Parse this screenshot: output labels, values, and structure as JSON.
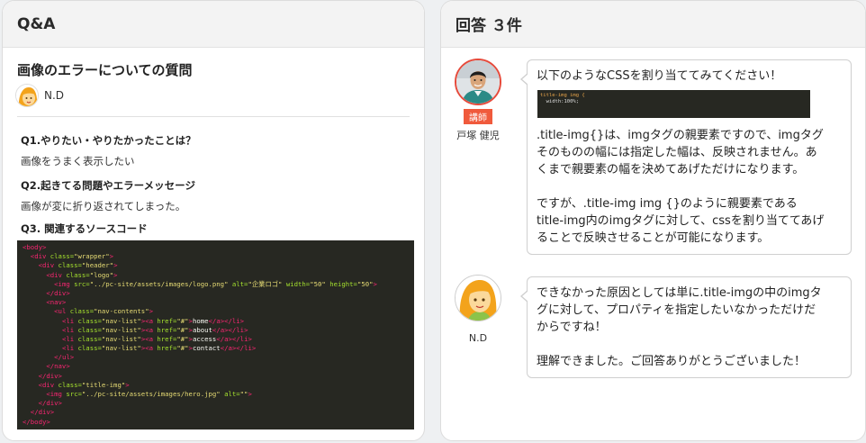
{
  "left_panel": {
    "header": "Q&A",
    "question_title": "画像のエラーについての質問",
    "asker_name": "N.D",
    "q1_heading": "Q1.やりたい・やりたかったことは？",
    "q1_text": "画像をうまく表示したい",
    "q2_heading": "Q2.起きてる問題やエラーメッセージ",
    "q2_text": "画像が変に折り返されてしまった。",
    "q3_heading": "Q3. 関連するソースコード",
    "code_lines": [
      [
        {
          "c": "tg",
          "t": "<body>"
        }
      ],
      [
        {
          "c": "tx",
          "t": "  "
        },
        {
          "c": "tg",
          "t": "<div "
        },
        {
          "c": "at",
          "t": "class="
        },
        {
          "c": "st",
          "t": "\"wrapper\""
        },
        {
          "c": "tg",
          "t": ">"
        }
      ],
      [
        {
          "c": "tx",
          "t": "    "
        },
        {
          "c": "tg",
          "t": "<div "
        },
        {
          "c": "at",
          "t": "class="
        },
        {
          "c": "st",
          "t": "\"header\""
        },
        {
          "c": "tg",
          "t": ">"
        }
      ],
      [
        {
          "c": "tx",
          "t": "      "
        },
        {
          "c": "tg",
          "t": "<div "
        },
        {
          "c": "at",
          "t": "class="
        },
        {
          "c": "st",
          "t": "\"logo\""
        },
        {
          "c": "tg",
          "t": ">"
        }
      ],
      [
        {
          "c": "tx",
          "t": "        "
        },
        {
          "c": "tg",
          "t": "<img "
        },
        {
          "c": "at",
          "t": "src="
        },
        {
          "c": "st",
          "t": "\"../pc-site/assets/images/logo.png\""
        },
        {
          "c": "tx",
          "t": " "
        },
        {
          "c": "at",
          "t": "alt="
        },
        {
          "c": "st",
          "t": "\"企業ロゴ\""
        },
        {
          "c": "tx",
          "t": " "
        },
        {
          "c": "at",
          "t": "width="
        },
        {
          "c": "st",
          "t": "\"50\""
        },
        {
          "c": "tx",
          "t": " "
        },
        {
          "c": "at",
          "t": "height="
        },
        {
          "c": "st",
          "t": "\"50\""
        },
        {
          "c": "tg",
          "t": ">"
        }
      ],
      [
        {
          "c": "tx",
          "t": "      "
        },
        {
          "c": "tg",
          "t": "</div>"
        }
      ],
      [
        {
          "c": "tx",
          "t": "      "
        },
        {
          "c": "tg",
          "t": "<nav>"
        }
      ],
      [
        {
          "c": "tx",
          "t": "        "
        },
        {
          "c": "tg",
          "t": "<ul "
        },
        {
          "c": "at",
          "t": "class="
        },
        {
          "c": "st",
          "t": "\"nav-contents\""
        },
        {
          "c": "tg",
          "t": ">"
        }
      ],
      [
        {
          "c": "tx",
          "t": "          "
        },
        {
          "c": "tg",
          "t": "<li "
        },
        {
          "c": "at",
          "t": "class="
        },
        {
          "c": "st",
          "t": "\"nav-list\""
        },
        {
          "c": "tg",
          "t": "><a "
        },
        {
          "c": "at",
          "t": "href="
        },
        {
          "c": "st",
          "t": "\"#\""
        },
        {
          "c": "tg",
          "t": ">"
        },
        {
          "c": "tx",
          "t": "home"
        },
        {
          "c": "tg",
          "t": "</a></li>"
        }
      ],
      [
        {
          "c": "tx",
          "t": "          "
        },
        {
          "c": "tg",
          "t": "<li "
        },
        {
          "c": "at",
          "t": "class="
        },
        {
          "c": "st",
          "t": "\"nav-list\""
        },
        {
          "c": "tg",
          "t": "><a "
        },
        {
          "c": "at",
          "t": "href="
        },
        {
          "c": "st",
          "t": "\"#\""
        },
        {
          "c": "tg",
          "t": ">"
        },
        {
          "c": "tx",
          "t": "about"
        },
        {
          "c": "tg",
          "t": "</a></li>"
        }
      ],
      [
        {
          "c": "tx",
          "t": "          "
        },
        {
          "c": "tg",
          "t": "<li "
        },
        {
          "c": "at",
          "t": "class="
        },
        {
          "c": "st",
          "t": "\"nav-list\""
        },
        {
          "c": "tg",
          "t": "><a "
        },
        {
          "c": "at",
          "t": "href="
        },
        {
          "c": "st",
          "t": "\"#\""
        },
        {
          "c": "tg",
          "t": ">"
        },
        {
          "c": "tx",
          "t": "access"
        },
        {
          "c": "tg",
          "t": "</a></li>"
        }
      ],
      [
        {
          "c": "tx",
          "t": "          "
        },
        {
          "c": "tg",
          "t": "<li "
        },
        {
          "c": "at",
          "t": "class="
        },
        {
          "c": "st",
          "t": "\"nav-list\""
        },
        {
          "c": "tg",
          "t": "><a "
        },
        {
          "c": "at",
          "t": "href="
        },
        {
          "c": "st",
          "t": "\"#\""
        },
        {
          "c": "tg",
          "t": ">"
        },
        {
          "c": "tx",
          "t": "contact"
        },
        {
          "c": "tg",
          "t": "</a></li>"
        }
      ],
      [
        {
          "c": "tx",
          "t": "        "
        },
        {
          "c": "tg",
          "t": "</ul>"
        }
      ],
      [
        {
          "c": "tx",
          "t": "      "
        },
        {
          "c": "tg",
          "t": "</nav>"
        }
      ],
      [
        {
          "c": "tx",
          "t": "    "
        },
        {
          "c": "tg",
          "t": "</div>"
        }
      ],
      [
        {
          "c": "tx",
          "t": "    "
        },
        {
          "c": "tg",
          "t": "<div "
        },
        {
          "c": "at",
          "t": "class="
        },
        {
          "c": "st",
          "t": "\"title-img\""
        },
        {
          "c": "tg",
          "t": ">"
        }
      ],
      [
        {
          "c": "tx",
          "t": "      "
        },
        {
          "c": "tg",
          "t": "<img "
        },
        {
          "c": "at",
          "t": "src="
        },
        {
          "c": "st",
          "t": "\"../pc-site/assets/images/hero.jpg\""
        },
        {
          "c": "tx",
          "t": " "
        },
        {
          "c": "at",
          "t": "alt="
        },
        {
          "c": "st",
          "t": "\"\""
        },
        {
          "c": "tg",
          "t": ">"
        }
      ],
      [
        {
          "c": "tx",
          "t": "    "
        },
        {
          "c": "tg",
          "t": "</div>"
        }
      ],
      [
        {
          "c": "tx",
          "t": "  "
        },
        {
          "c": "tg",
          "t": "</div>"
        }
      ],
      [
        {
          "c": "tg",
          "t": "</body>"
        }
      ]
    ]
  },
  "right_panel": {
    "header": "回答 ３件",
    "answer1": {
      "author_badge": "講師",
      "author_name": "戸塚 健児",
      "intro": "以下のようなCSSを割り当ててみてください！",
      "mini_code_line1": "title-img img {",
      "mini_code_line2": "  width:100%;",
      "para1_l1": ".title-img{}は、imgタグの親要素ですので、imgタグ",
      "para1_l2": "そのものの幅には指定した幅は、反映されません。あ",
      "para1_l3": "くまで親要素の幅を決めてあげただけになります。",
      "para2_l1": "ですが、.title-img img {}のように親要素である",
      "para2_l2": "title-img内のimgタグに対して、cssを割り当ててあげ",
      "para2_l3": "ることで反映させることが可能になります。"
    },
    "answer2": {
      "author_name": "N.D",
      "para1_l1": "できなかった原因としては単に.title-imgの中のimgタ",
      "para1_l2": "グに対して、プロパティを指定したいなかっただけだ",
      "para1_l3": "からですね！",
      "para2_l1": "理解できました。ご回答ありがとうございました！"
    }
  },
  "colors": {
    "accent": "#f05a3c",
    "code_bg": "#272822"
  }
}
